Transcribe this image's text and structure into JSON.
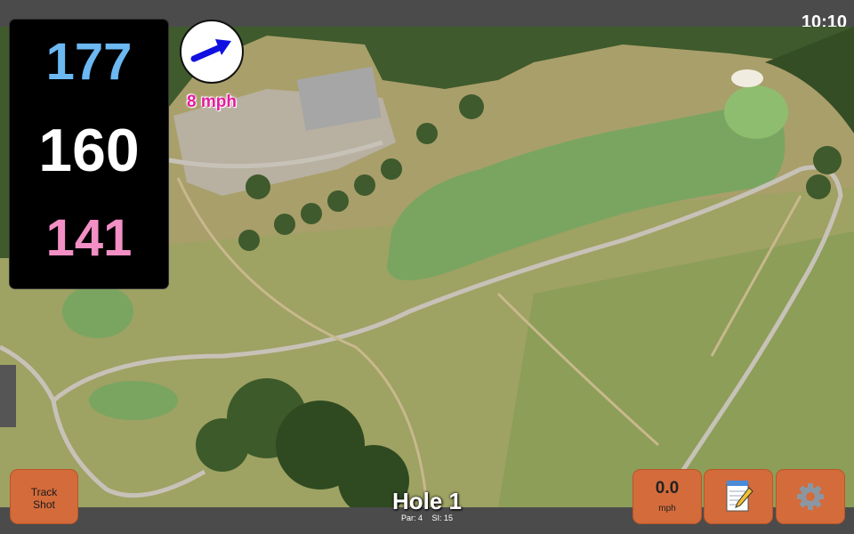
{
  "status_bar": {
    "time": "10:10"
  },
  "yardage": {
    "back": "177",
    "middle": "160",
    "front": "141"
  },
  "wind": {
    "speed": "8 mph",
    "icon": "wind-direction-arrow-icon"
  },
  "hole": {
    "title": "Hole 1",
    "par": "Par: 4",
    "stroke_index": "SI: 15"
  },
  "buttons": {
    "track_shot_line1": "Track",
    "track_shot_line2": "Shot",
    "speed_value": "0.0",
    "speed_unit": "mph",
    "notes_icon": "notepad-icon",
    "settings_icon": "gear-icon"
  },
  "colors": {
    "back_yardage": "#6bb8f2",
    "middle_yardage": "#ffffff",
    "front_yardage": "#f28fc4",
    "wind_text": "#e61aa0",
    "button": "#d46b3b"
  }
}
